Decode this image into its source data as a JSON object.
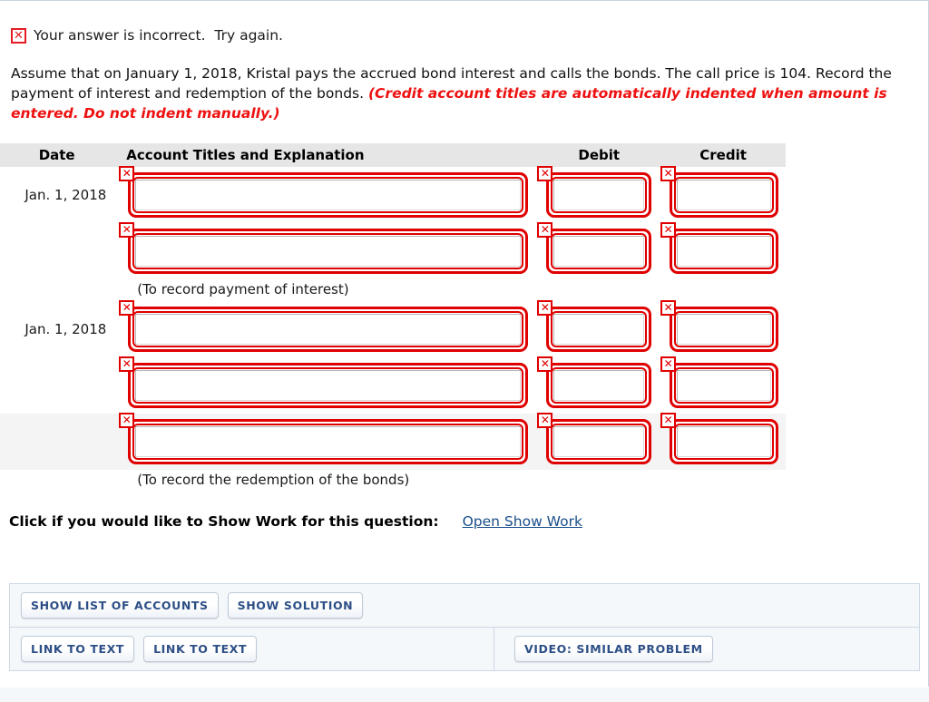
{
  "status": {
    "icon": "x-error-icon",
    "icon_glyph": "✕",
    "text": "Your answer is incorrect.  Try again.",
    "color": "#e31b23"
  },
  "question": {
    "body": "Assume that on January 1, 2018, Kristal pays the accrued bond interest and calls the bonds. The call price is 104. Record the payment of interest and redemption of the bonds. ",
    "hint": "(Credit account titles are automatically indented when amount is entered. Do not indent manually.)",
    "hint_color": "#ee1111"
  },
  "table": {
    "headers": {
      "date": "Date",
      "account": "Account Titles and Explanation",
      "debit": "Debit",
      "credit": "Credit"
    },
    "header_bg": "#e6e6e6",
    "error_color": "#e00000",
    "error_badge_glyph": "✕",
    "rows": [
      {
        "type": "entry",
        "date": "Jan. 1, 2018",
        "account": "",
        "debit": "",
        "credit": "",
        "shaded": false,
        "error": true
      },
      {
        "type": "entry",
        "date": "",
        "account": "",
        "debit": "",
        "credit": "",
        "shaded": false,
        "error": true
      },
      {
        "type": "note",
        "text": "(To record payment of interest)"
      },
      {
        "type": "entry",
        "date": "Jan. 1, 2018",
        "account": "",
        "debit": "",
        "credit": "",
        "shaded": false,
        "error": true
      },
      {
        "type": "entry",
        "date": "",
        "account": "",
        "debit": "",
        "credit": "",
        "shaded": false,
        "error": true
      },
      {
        "type": "entry",
        "date": "",
        "account": "",
        "debit": "",
        "credit": "",
        "shaded": true,
        "error": true
      },
      {
        "type": "note",
        "text": "(To record the redemption of the bonds)"
      }
    ]
  },
  "show_work": {
    "label": "Click if you would like to Show Work for this question:",
    "link": "Open Show Work",
    "link_color": "#1a4f8a"
  },
  "buttons": {
    "show_list_of_accounts": "SHOW LIST OF ACCOUNTS",
    "show_solution": "SHOW SOLUTION",
    "link_to_text_1": "LINK TO TEXT",
    "link_to_text_2": "LINK TO TEXT",
    "video_similar_problem": "VIDEO: SIMILAR PROBLEM",
    "text_color": "#2d4f86"
  }
}
